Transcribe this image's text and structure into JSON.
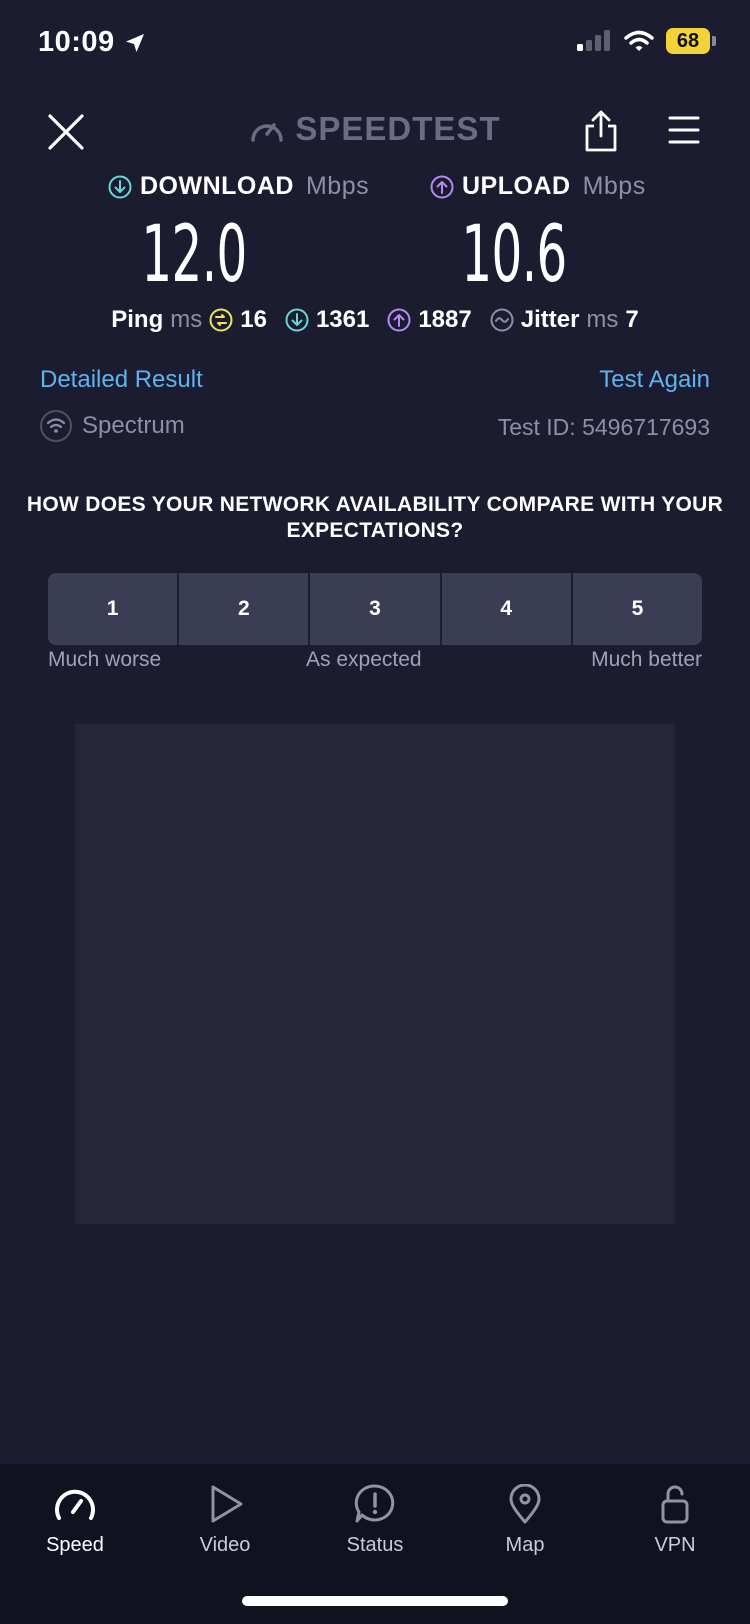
{
  "status_bar": {
    "time": "10:09",
    "battery": "68"
  },
  "header": {
    "brand": "SPEEDTEST"
  },
  "download": {
    "label": "DOWNLOAD",
    "unit": "Mbps",
    "value": "12.0"
  },
  "upload": {
    "label": "UPLOAD",
    "unit": "Mbps",
    "value": "10.6"
  },
  "ping": {
    "label": "Ping",
    "unit": "ms",
    "idle": "16",
    "download": "1361",
    "upload": "1887",
    "jitter_label": "Jitter",
    "jitter_unit": "ms",
    "jitter": "7"
  },
  "links": {
    "detailed": "Detailed Result",
    "again": "Test Again"
  },
  "connection": {
    "isp": "Spectrum",
    "test_id": "Test ID: 5496717693"
  },
  "survey": {
    "question": "HOW DOES YOUR NETWORK AVAILABILITY COMPARE WITH YOUR EXPECTATIONS?",
    "options": [
      "1",
      "2",
      "3",
      "4",
      "5"
    ],
    "low_label": "Much worse",
    "mid_label": "As expected",
    "high_label": "Much better"
  },
  "tabs": [
    {
      "label": "Speed"
    },
    {
      "label": "Video"
    },
    {
      "label": "Status"
    },
    {
      "label": "Map"
    },
    {
      "label": "VPN"
    }
  ],
  "colors": {
    "background": "#1b1c30",
    "download_accent": "#67d8d6",
    "upload_accent": "#b48bf2",
    "ping_accent": "#f2e35a",
    "link": "#5fb3ee"
  }
}
